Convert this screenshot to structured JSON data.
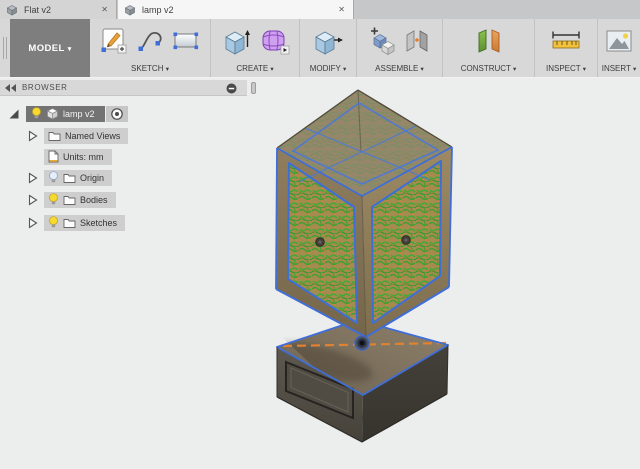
{
  "window": {
    "tabs": [
      {
        "label": "Flat v2"
      },
      {
        "label": "lamp v2"
      }
    ],
    "close_glyph": "✕"
  },
  "toolbar": {
    "workspace": "MODEL",
    "caret": "▾",
    "groups": [
      {
        "label": "SKETCH",
        "icons": [
          "create-sketch",
          "spline",
          "two-point-rectangle"
        ]
      },
      {
        "label": "CREATE",
        "icons": [
          "extrude",
          "create-form"
        ]
      },
      {
        "label": "MODIFY",
        "icons": [
          "press-pull"
        ]
      },
      {
        "label": "ASSEMBLE",
        "icons": [
          "new-component",
          "joint"
        ]
      },
      {
        "label": "CONSTRUCT",
        "icons": [
          "construction-plane"
        ]
      },
      {
        "label": "INSPECT",
        "icons": [
          "measure"
        ]
      },
      {
        "label": "INSERT",
        "icons": [
          "insert-image"
        ]
      }
    ]
  },
  "browser": {
    "title": "BROWSER",
    "tree": [
      {
        "label": "lamp v2",
        "icon": "component-cube",
        "bulb": "on",
        "selected": true,
        "expanded": true,
        "radio": true
      },
      {
        "label": "Named Views",
        "icon": "folder"
      },
      {
        "label": "Units: mm",
        "icon": "document"
      },
      {
        "label": "Origin",
        "icon": "folder",
        "bulb": "off"
      },
      {
        "label": "Bodies",
        "icon": "folder",
        "bulb": "on"
      },
      {
        "label": "Sketches",
        "icon": "folder",
        "bulb": "on"
      }
    ]
  },
  "viewport": {
    "model_name": "lamp v2",
    "colors": {
      "edge_highlight_blue": "#3f6ed8",
      "panel_green": "#3fa12f",
      "panel_tan": "#a78a50",
      "sketch_dash_orange": "#e2812f",
      "lantern_brown": "#8a795a",
      "base_gray": "#57524a"
    }
  }
}
